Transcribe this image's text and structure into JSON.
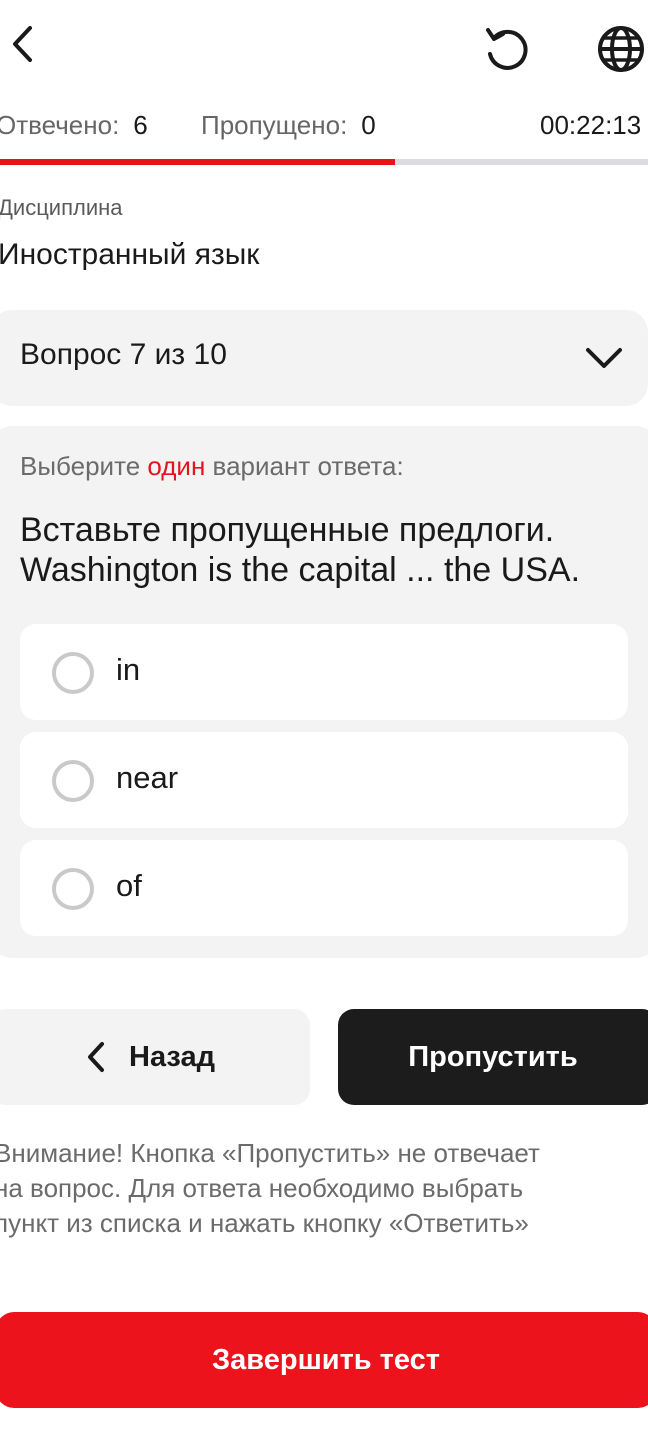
{
  "header": {
    "back_icon": "chevron-left-icon",
    "reset_icon": "reset-icon",
    "language_icon": "globe-icon"
  },
  "stats": {
    "answered_label": "Отвечено:",
    "answered_value": "6",
    "skipped_label": "Пропущено:",
    "skipped_value": "0",
    "timer": "00:22:13",
    "progress_fraction": 0.61
  },
  "discipline": {
    "label": "Дисциплина",
    "value": "Иностранный язык"
  },
  "question_selector": {
    "label": "Вопрос 7 из 10",
    "icon": "chevron-down-icon"
  },
  "question": {
    "instruction_prefix": "Выберите ",
    "instruction_accent": "один",
    "instruction_suffix": " вариант ответа:",
    "text_line1": "Вставьте пропущенные предлоги.",
    "text_line2": "Washington is the capital ... the USA.",
    "options": [
      {
        "label": "in"
      },
      {
        "label": "near"
      },
      {
        "label": "of"
      }
    ]
  },
  "nav": {
    "back_label": "Назад",
    "skip_label": "Пропустить"
  },
  "notice": {
    "line1": "Внимание! Кнопка «Пропустить» не отвечает",
    "line2": "на вопрос. Для ответа необходимо выбрать",
    "line3": "пункт из списка и нажать кнопку «Ответить»"
  },
  "finish": {
    "label": "Завершить тест"
  },
  "colors": {
    "accent": "#e3141c",
    "finish": "#ec131c",
    "dark_button": "#1c1c1c",
    "card_bg": "#f3f3f3"
  }
}
